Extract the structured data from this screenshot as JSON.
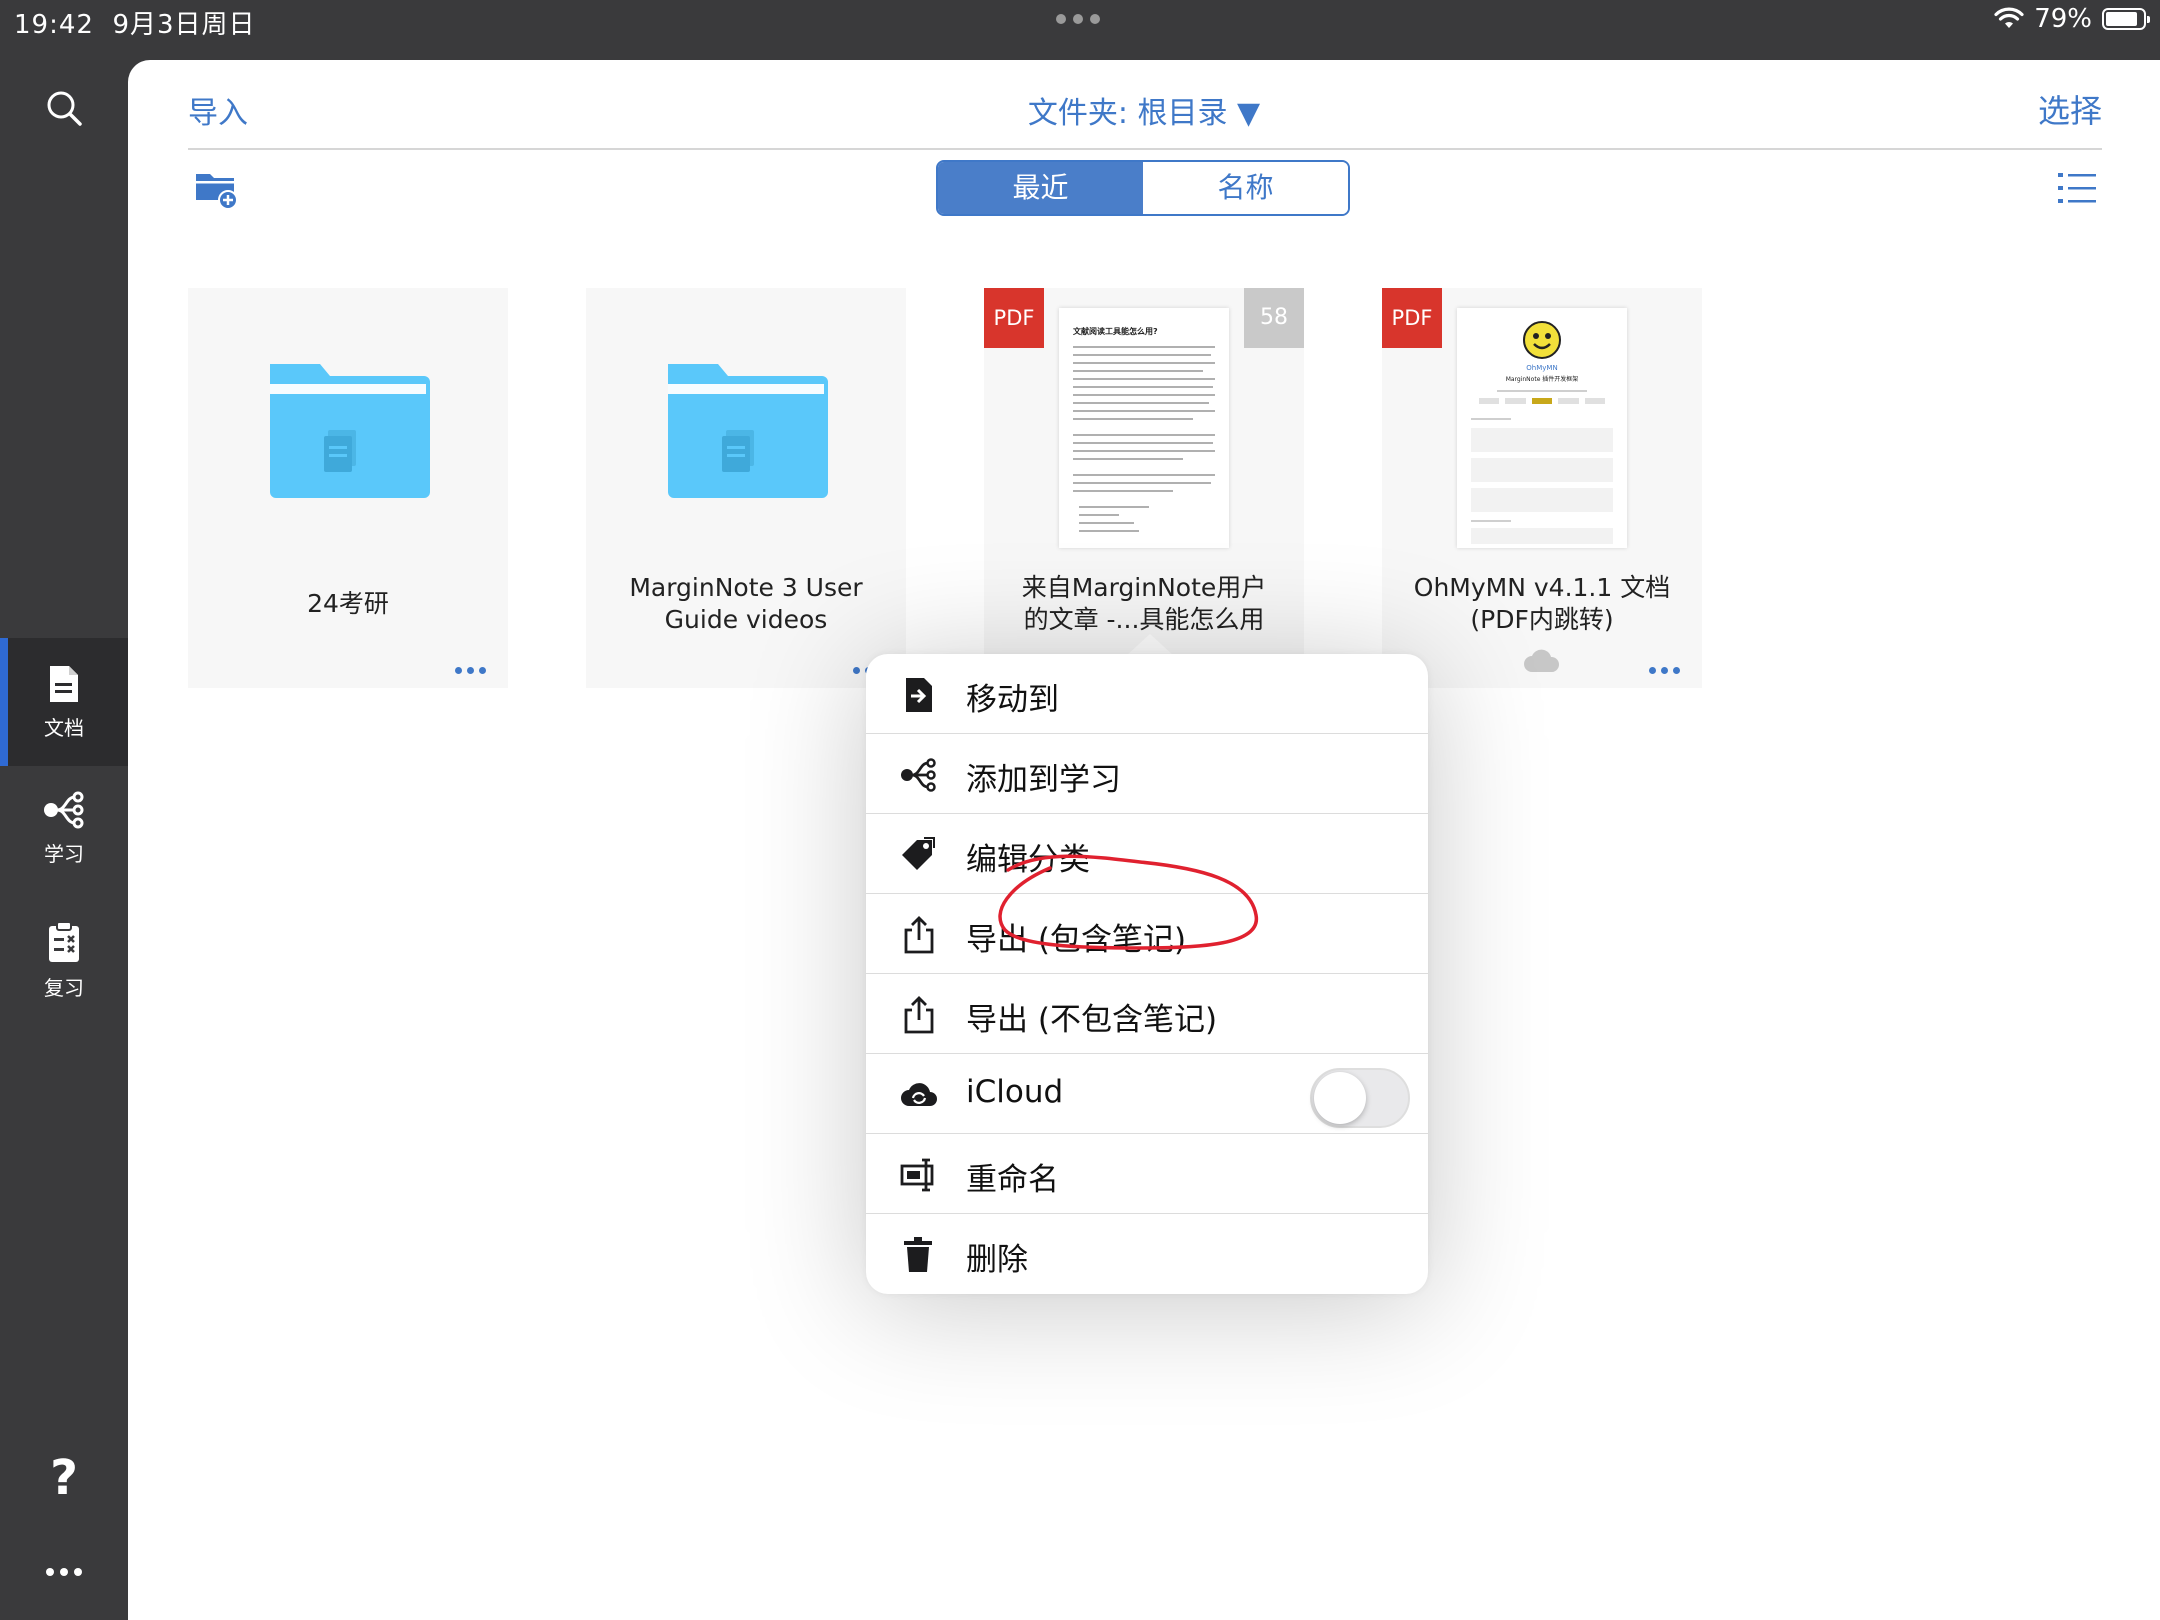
{
  "status": {
    "time": "19:42",
    "date": "9月3日周日",
    "battery": "79%",
    "battery_level": 0.79
  },
  "sidebar": {
    "items": [
      {
        "label": "文档",
        "active": true
      },
      {
        "label": "学习"
      },
      {
        "label": "复习"
      }
    ],
    "help": "?"
  },
  "topbar": {
    "import": "导入",
    "folder": "文件夹: 根目录 ▼",
    "select": "选择"
  },
  "sort": {
    "recent": "最近",
    "name": "名称",
    "selected": "最近"
  },
  "cards": [
    {
      "title": "24考研",
      "type": "folder"
    },
    {
      "title_l1": "MarginNote 3 User",
      "title_l2": "Guide videos",
      "type": "folder"
    },
    {
      "title_l1": "来自MarginNote用户",
      "title_l2": "的文章 -...具能怎么用",
      "type": "pdf",
      "badge": "PDF",
      "count": "58",
      "thumb_title": "文献阅读工具能怎么用?"
    },
    {
      "title_l1": "OhMyMN v4.1.1 文档",
      "title_l2": "(PDF内跳转)",
      "type": "pdf",
      "badge": "PDF",
      "thumb_title": "OhMyMN",
      "thumb_sub": "MarginNote 插件开发框架"
    }
  ],
  "menu": {
    "items": [
      {
        "label": "移动到",
        "icon": "move-to-icon"
      },
      {
        "label": "添加到学习",
        "icon": "mindmap-icon"
      },
      {
        "label": "编辑分类",
        "icon": "tag-icon",
        "highlighted": true
      },
      {
        "label": "导出 (包含笔记)",
        "icon": "share-icon"
      },
      {
        "label": "导出 (不包含笔记)",
        "icon": "share-icon"
      },
      {
        "label": "iCloud",
        "icon": "icloud-icon",
        "toggle": false
      },
      {
        "label": "重命名",
        "icon": "rename-icon"
      },
      {
        "label": "删除",
        "icon": "trash-icon"
      }
    ]
  },
  "colors": {
    "accent": "#3f78c8",
    "pdf_badge": "#d8352c",
    "folder": "#5ac8fa",
    "annotation": "#e0212f"
  }
}
